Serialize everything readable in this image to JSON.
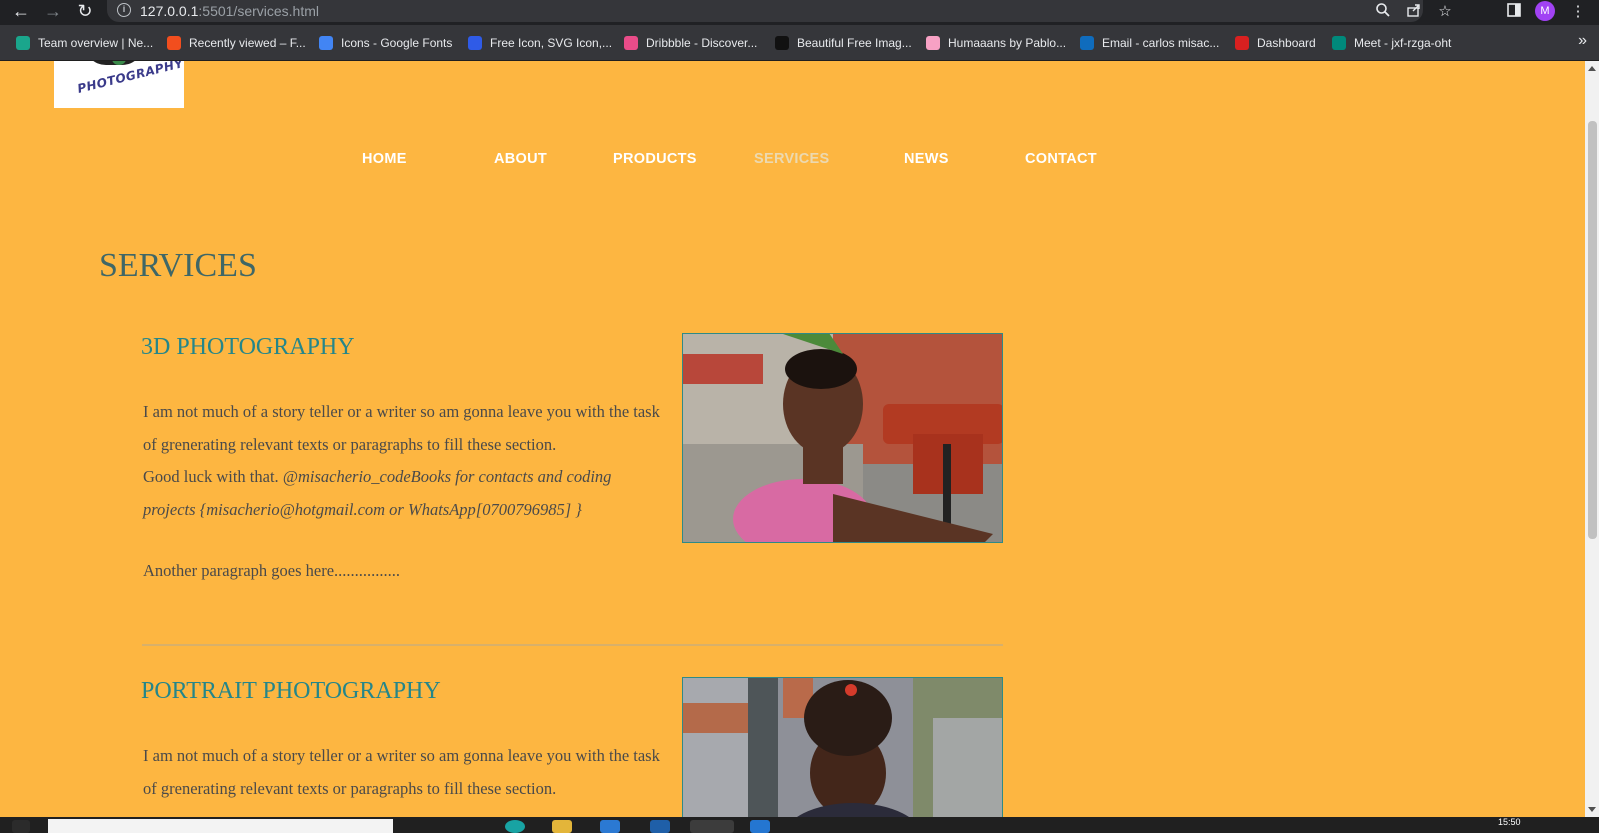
{
  "browser": {
    "back_icon": "←",
    "forward_icon": "→",
    "reload_icon": "↻",
    "url_host": "127.0.0.1",
    "url_rest": ":5501/services.html",
    "avatar_letter": "M",
    "bookmarks": [
      {
        "label": "Team overview | Ne...",
        "color": "#1aa68c"
      },
      {
        "label": "Recently viewed – F...",
        "color": "#f24e1e"
      },
      {
        "label": "Icons - Google Fonts",
        "color": "#4285f4"
      },
      {
        "label": "Free Icon, SVG Icon,...",
        "color": "#2f5be7"
      },
      {
        "label": "Dribbble - Discover...",
        "color": "#ea4c89"
      },
      {
        "label": "Beautiful Free Imag...",
        "color": "#111111"
      },
      {
        "label": "Humaaans by Pablo...",
        "color": "#f7a1c4"
      },
      {
        "label": "Email - carlos misac...",
        "color": "#0f6cbd"
      },
      {
        "label": "Dashboard",
        "color": "#d92020"
      },
      {
        "label": "Meet - jxf-rzga-oht",
        "color": "#00897b"
      }
    ],
    "bookmarks_more": "»"
  },
  "site": {
    "logo_text": "PHOTOGRAPHY",
    "nav": [
      "HOME",
      "ABOUT",
      "PRODUCTS",
      "SERVICES",
      "NEWS",
      "CONTACT"
    ],
    "active_nav": "SERVICES"
  },
  "main": {
    "heading": "SERVICES",
    "services": [
      {
        "title": "3D PHOTOGRAPHY",
        "body_plain": "I am not much of a story teller or a writer so am gonna leave you with the task of grenerating relevant texts or paragraphs to fill these section.",
        "body_lead": "Good luck with that.",
        "body_italic": "@misacherio_codeBooks for contacts and coding projects {misacherio@hotgmail.com or WhatsApp[0700796985] }",
        "extra": "Another paragraph goes here................"
      },
      {
        "title": "PORTRAIT PHOTOGRAPHY",
        "body_plain": "I am not much of a story teller or a writer so am gonna leave you with the task of grenerating relevant texts or paragraphs to fill these section."
      }
    ]
  },
  "taskbar": {
    "clock": "15:50"
  }
}
